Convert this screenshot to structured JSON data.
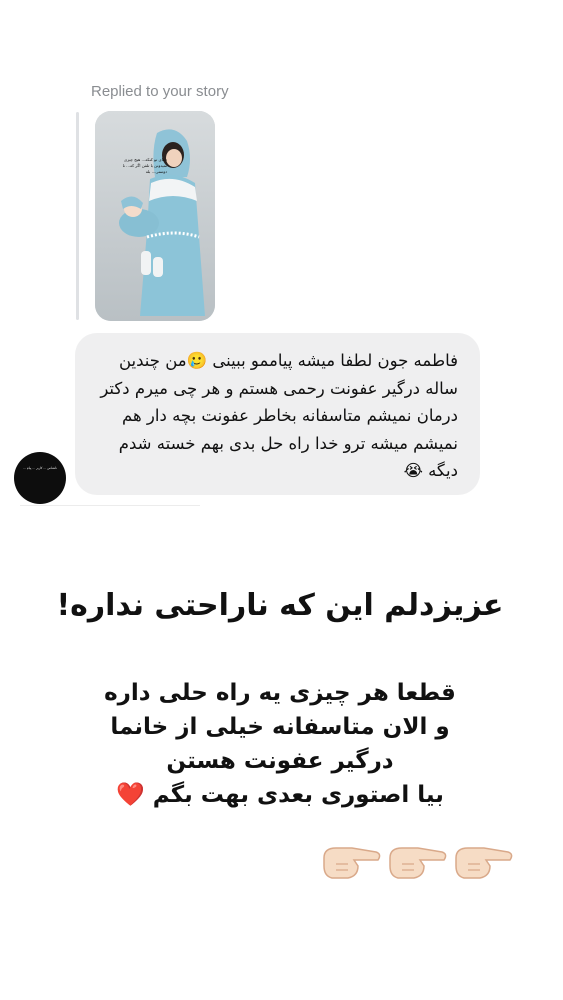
{
  "reply_header": {
    "label": "Replied to your story"
  },
  "story": {
    "overlay_text": "دعای تو کنکه... هیچ چیزی نمیدونن با تلفن اگر که... نا دوستی... بله"
  },
  "message": {
    "text": "فاطمه جون لطفا میشه پیاممو ببینی 🥲من چندین ساله درگیر عفونت رحمی هستم و هر چی میرم دکتر درمان نمیشم متاسفانه بخاطر عفونت بچه دار هم نمیشم میشه ترو خدا راه حل بدی بهم خسته شدم دیگه 😭"
  },
  "sender": {
    "avatar_text": "ناشناس ... کاربر ... پیام ..."
  },
  "response": {
    "headline": "عزیزدلم این که ناراحتی نداره!",
    "line1": "قطعا هر چیزی یه راه حلی داره",
    "line2": "و الان متاسفانه خیلی از خانما",
    "line3": "درگیر عفونت هستن",
    "line4": "بیا اصتوری بعدی بهت بگم ❤️"
  },
  "icons": {
    "pointer": "backhand-index-pointing-right-icon",
    "skin_color": "#f6dcc5",
    "outline_color": "#d9a98a"
  }
}
